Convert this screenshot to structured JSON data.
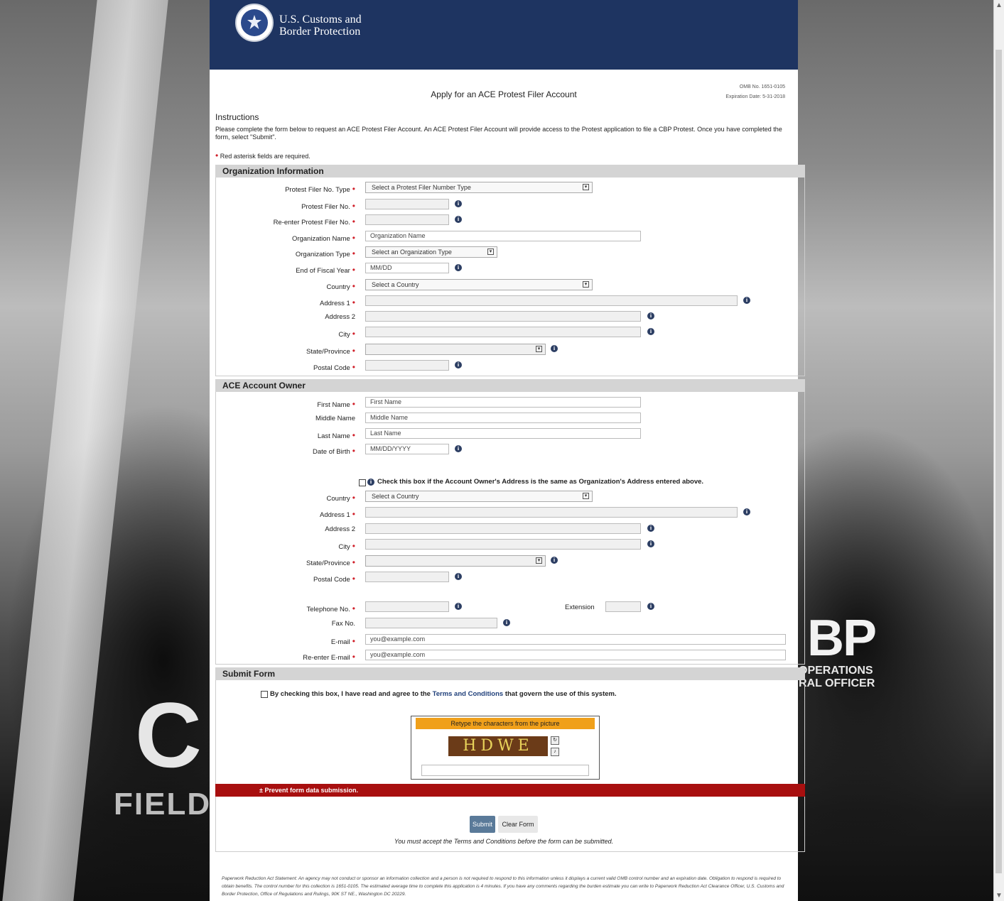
{
  "header": {
    "agency_line1": "U.S. Customs and",
    "agency_line2": "Border Protection"
  },
  "omb": {
    "number": "OMB No. 1651-0105",
    "expiration": "Expiration Date: 5-31-2018"
  },
  "title": "Apply for an ACE Protest Filer Account",
  "instructions": {
    "heading": "Instructions",
    "text": "Please complete the form below to request an ACE Protest Filer Account. An ACE Protest Filer Account will provide access to the Protest application to file a CBP Protest. Once you have completed the form, select \"Submit\".",
    "required_note": "Red asterisk fields are required."
  },
  "org": {
    "heading": "Organization Information",
    "filer_type_label": "Protest Filer No. Type",
    "filer_type_value": "Select a Protest Filer Number Type",
    "filer_no_label": "Protest Filer No.",
    "reenter_filer_label": "Re-enter Protest Filer No.",
    "org_name_label": "Organization Name",
    "org_name_placeholder": "Organization Name",
    "org_type_label": "Organization Type",
    "org_type_value": "Select an Organization Type",
    "fiscal_label": "End of Fiscal Year",
    "fiscal_placeholder": "MM/DD",
    "country_label": "Country",
    "country_value": "Select a Country",
    "address1_label": "Address 1",
    "address2_label": "Address 2",
    "city_label": "City",
    "state_label": "State/Province",
    "postal_label": "Postal Code"
  },
  "owner": {
    "heading": "ACE Account Owner",
    "first_label": "First Name",
    "first_placeholder": "First Name",
    "middle_label": "Middle Name",
    "middle_placeholder": "Middle Name",
    "last_label": "Last Name",
    "last_placeholder": "Last Name",
    "dob_label": "Date of Birth",
    "dob_placeholder": "MM/DD/YYYY",
    "same_address_text": "Check this box if the Account Owner's Address is the same as Organization's Address entered above.",
    "country_label": "Country",
    "country_value": "Select a Country",
    "address1_label": "Address 1",
    "address2_label": "Address 2",
    "city_label": "City",
    "state_label": "State/Province",
    "postal_label": "Postal Code",
    "phone_label": "Telephone No.",
    "ext_label": "Extension",
    "fax_label": "Fax No.",
    "email_label": "E-mail",
    "email_placeholder": "you@example.com",
    "reemail_label": "Re-enter E-mail",
    "reemail_placeholder": "you@example.com"
  },
  "submit": {
    "heading": "Submit Form",
    "terms_pre": "By checking this box, I have read and agree to the",
    "terms_link": "Terms and Conditions",
    "terms_post": "that govern the use of this system.",
    "captcha_heading": "Retype the characters from the picture",
    "captcha_text": "HDWE",
    "prevent_text": "Prevent form data submission.",
    "submit_label": "Submit",
    "clear_label": "Clear Form",
    "must_accept": "You must accept the Terms and Conditions before the form can be submitted."
  },
  "paperwork": "Paperwork Reduction Act Statement: An agency may not conduct or sponsor an information collection and a person is not required to respond to this information unless it displays a current valid OMB control number and an expiration date. Obligation to respond is required to obtain benefits. The control number for this collection is 1651-0105. The estimated average time to complete this application is 4 minutes. If you have any comments regarding the burden estimate you can write to Paperwork Reduction Act Clearance Officer, U.S. Customs and Border Protection, Office of Regulations and Rulings, 90K ST NE., Washington DC 20229.",
  "background": {
    "cbp": "BP",
    "ops_line1": "OPERATIONS",
    "ops_line2": "RAL OFFICER",
    "c": "C",
    "field": "FIELD"
  },
  "colors": {
    "header": "#1e3461",
    "required": "#d0202a",
    "alert_bar": "#a80f0f",
    "captcha_head": "#f0a01a",
    "submit_btn": "#5a7a99"
  }
}
